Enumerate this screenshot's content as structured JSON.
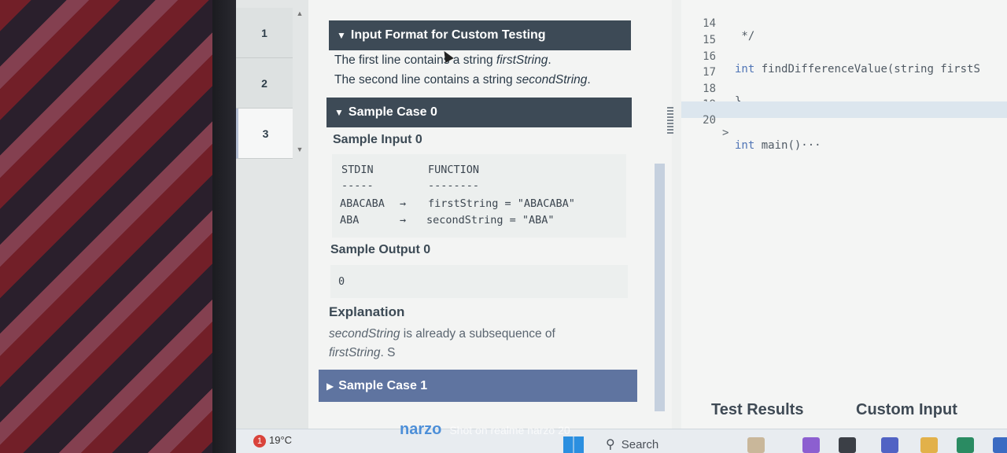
{
  "tabs": [
    {
      "label": "1"
    },
    {
      "label": "2"
    },
    {
      "label": "3"
    }
  ],
  "problem": {
    "input_format": {
      "title": "Input Format for Custom Testing",
      "line1_prefix": "The first line contains a string ",
      "line1_var": "firstString",
      "line1_suffix": ".",
      "line2_prefix": "The second line contains a string ",
      "line2_var": "secondString",
      "line2_suffix": "."
    },
    "sample_case_0": {
      "title": "Sample Case 0",
      "sample_input_label": "Sample Input 0",
      "stdin_header": "STDIN",
      "function_header": "FUNCTION",
      "stdin_dashes": "-----",
      "function_dashes": "--------",
      "rows": [
        {
          "stdin": "ABACABA",
          "arrow": "→",
          "func": "firstString = \"ABACABA\""
        },
        {
          "stdin": "ABA",
          "arrow": "→",
          "func": "secondString = \"ABA\""
        }
      ],
      "sample_output_label": "Sample Output 0",
      "output_value": "0",
      "explanation_label": "Explanation",
      "explanation_var1": "secondString",
      "explanation_mid": " is already a subsequence of ",
      "explanation_var2": "firstString",
      "explanation_end": ". S"
    },
    "sample_case_1": {
      "title": "Sample Case 1"
    }
  },
  "editor": {
    "lines": [
      {
        "num": "14",
        "fold": "",
        "kw": "",
        "code": " */"
      },
      {
        "num": "15",
        "fold": "",
        "kw": "",
        "code": ""
      },
      {
        "num": "16",
        "fold": "",
        "kw": "int",
        "code": " findDifferenceValue(string firstS"
      },
      {
        "num": "17",
        "fold": "",
        "kw": "",
        "code": ""
      },
      {
        "num": "18",
        "fold": "",
        "kw": "",
        "code": "}"
      },
      {
        "num": "19",
        "fold": "",
        "kw": "",
        "code": ""
      },
      {
        "num": "20",
        "fold": ">",
        "kw": "int",
        "code": " main()···"
      }
    ],
    "bottom_tabs": {
      "test_results": "Test Results",
      "custom_input": "Custom Input"
    }
  },
  "taskbar": {
    "weather_badge": "1",
    "weather_temp": "19°C",
    "search_label": "Search"
  },
  "watermark": {
    "brand": "narzo",
    "text": "Shot on realme narzo 20"
  }
}
